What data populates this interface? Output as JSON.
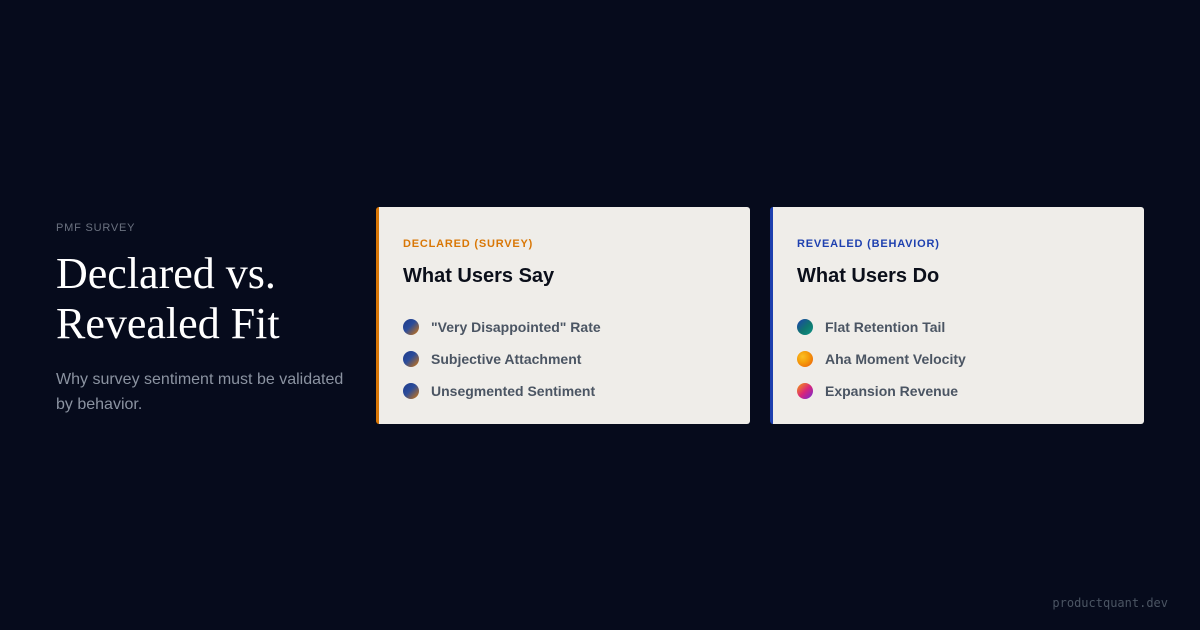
{
  "intro": {
    "eyebrow": "PMF SURVEY",
    "headline_line1": "Declared vs.",
    "headline_line2": "Revealed Fit",
    "subtitle": "Why survey sentiment must be validated by behavior."
  },
  "cards": [
    {
      "label": "DECLARED (SURVEY)",
      "title": "What Users Say",
      "accent_color": "#d97706",
      "items": [
        {
          "text": "\"Very Disappointed\" Rate",
          "icon": "survey-dot-icon"
        },
        {
          "text": "Subjective Attachment",
          "icon": "survey-dot-icon"
        },
        {
          "text": "Unsegmented Sentiment",
          "icon": "survey-dot-icon"
        }
      ]
    },
    {
      "label": "REVEALED (BEHAVIOR)",
      "title": "What Users Do",
      "accent_color": "#1e40af",
      "items": [
        {
          "text": "Flat Retention Tail",
          "icon": "retention-dot-icon"
        },
        {
          "text": "Aha Moment Velocity",
          "icon": "aha-dot-icon"
        },
        {
          "text": "Expansion Revenue",
          "icon": "expansion-dot-icon"
        }
      ]
    }
  ],
  "footer": {
    "domain": "productquant.dev"
  },
  "colors": {
    "background": "#060b1c",
    "card_background": "#efede9",
    "declared_accent": "#d97706",
    "revealed_accent": "#1e40af"
  }
}
